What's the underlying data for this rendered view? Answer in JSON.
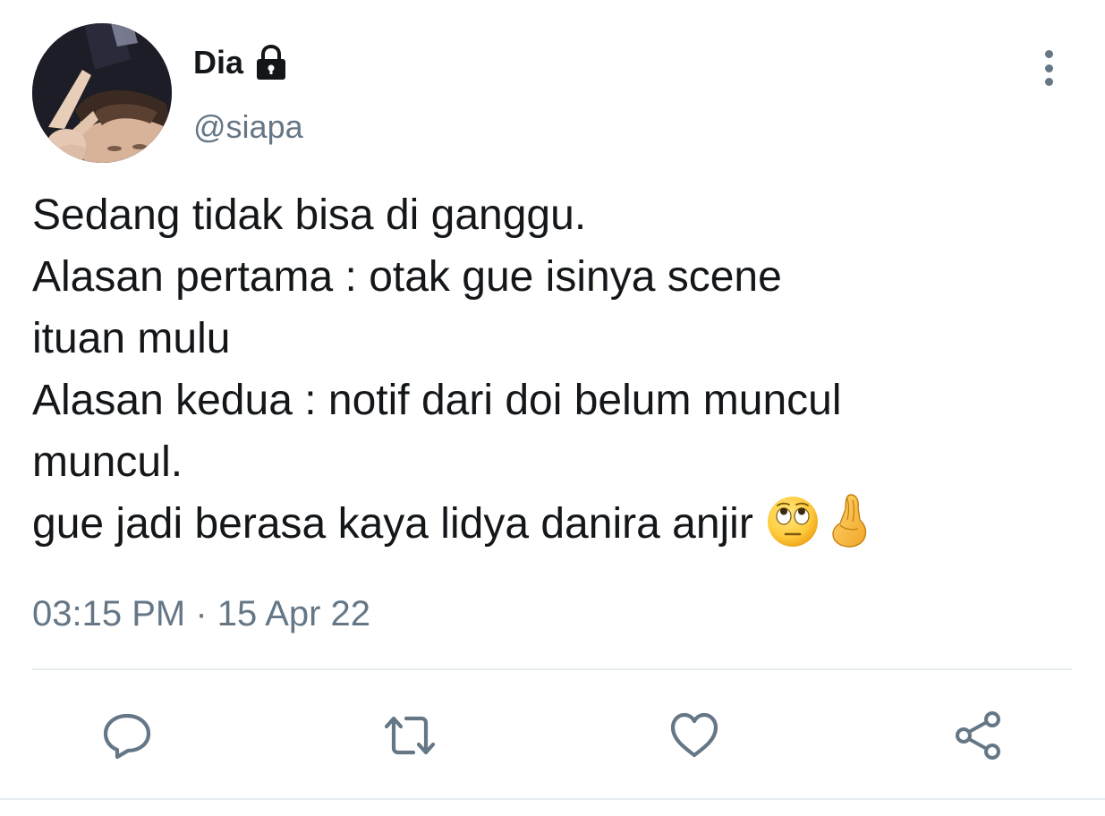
{
  "tweet": {
    "author": {
      "display_name": "Dia",
      "handle": "@siapa",
      "protected_icon": "lock-icon",
      "avatar": "profile-photo"
    },
    "menu_icon": "more-vertical-icon",
    "text_lines": [
      "Sedang tidak bisa di ganggu.",
      "Alasan pertama : otak gue isinya scene",
      "ituan mulu",
      "Alasan kedua : notif dari doi belum muncul",
      "muncul.",
      "gue jadi berasa kaya lidya danira anjir"
    ],
    "emojis": [
      "face-with-rolling-eyes-emoji",
      "pinched-fingers-emoji"
    ],
    "time": "03:15 PM",
    "separator": "·",
    "date": "15 Apr 22"
  },
  "actions": [
    {
      "icon": "reply-icon"
    },
    {
      "icon": "retweet-icon"
    },
    {
      "icon": "like-icon"
    },
    {
      "icon": "share-icon"
    }
  ],
  "colors": {
    "text_primary": "#14171a",
    "text_secondary": "#657786",
    "divider": "#e6ecf0",
    "background": "#ffffff"
  }
}
